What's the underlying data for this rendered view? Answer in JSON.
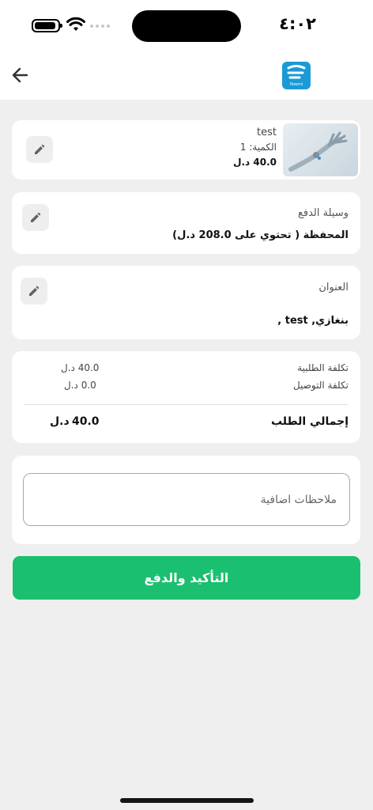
{
  "status_bar": {
    "time": "٤:٠٢"
  },
  "app_bar": {
    "logo_text": "flowmi"
  },
  "product": {
    "name": "test",
    "quantity": "الكمية: 1",
    "price": "40.0 د.ل"
  },
  "payment": {
    "label": "وسيلة الدفع",
    "value": "المحفظة  ( تحتوي على 208.0 د.ل)"
  },
  "address": {
    "label": "العنوان",
    "value": "بنغازي, test ,"
  },
  "summary": {
    "order_cost_label": "تكلفة الطلبية",
    "order_cost_value": "40.0 د.ل",
    "delivery_cost_label": "تكلفة التوصيل",
    "delivery_cost_value": "0.0 د.ل",
    "total_label": "إجمالي الطلب",
    "total_amount": "40.0",
    "total_currency": "د.ل"
  },
  "notes": {
    "placeholder": "ملاحظات اضافية",
    "value": ""
  },
  "confirm_button": {
    "label": "التأكيد والدفع"
  },
  "colors": {
    "primary": "#1bbf70",
    "logo": "#1a9ad6",
    "background": "#efefef"
  }
}
